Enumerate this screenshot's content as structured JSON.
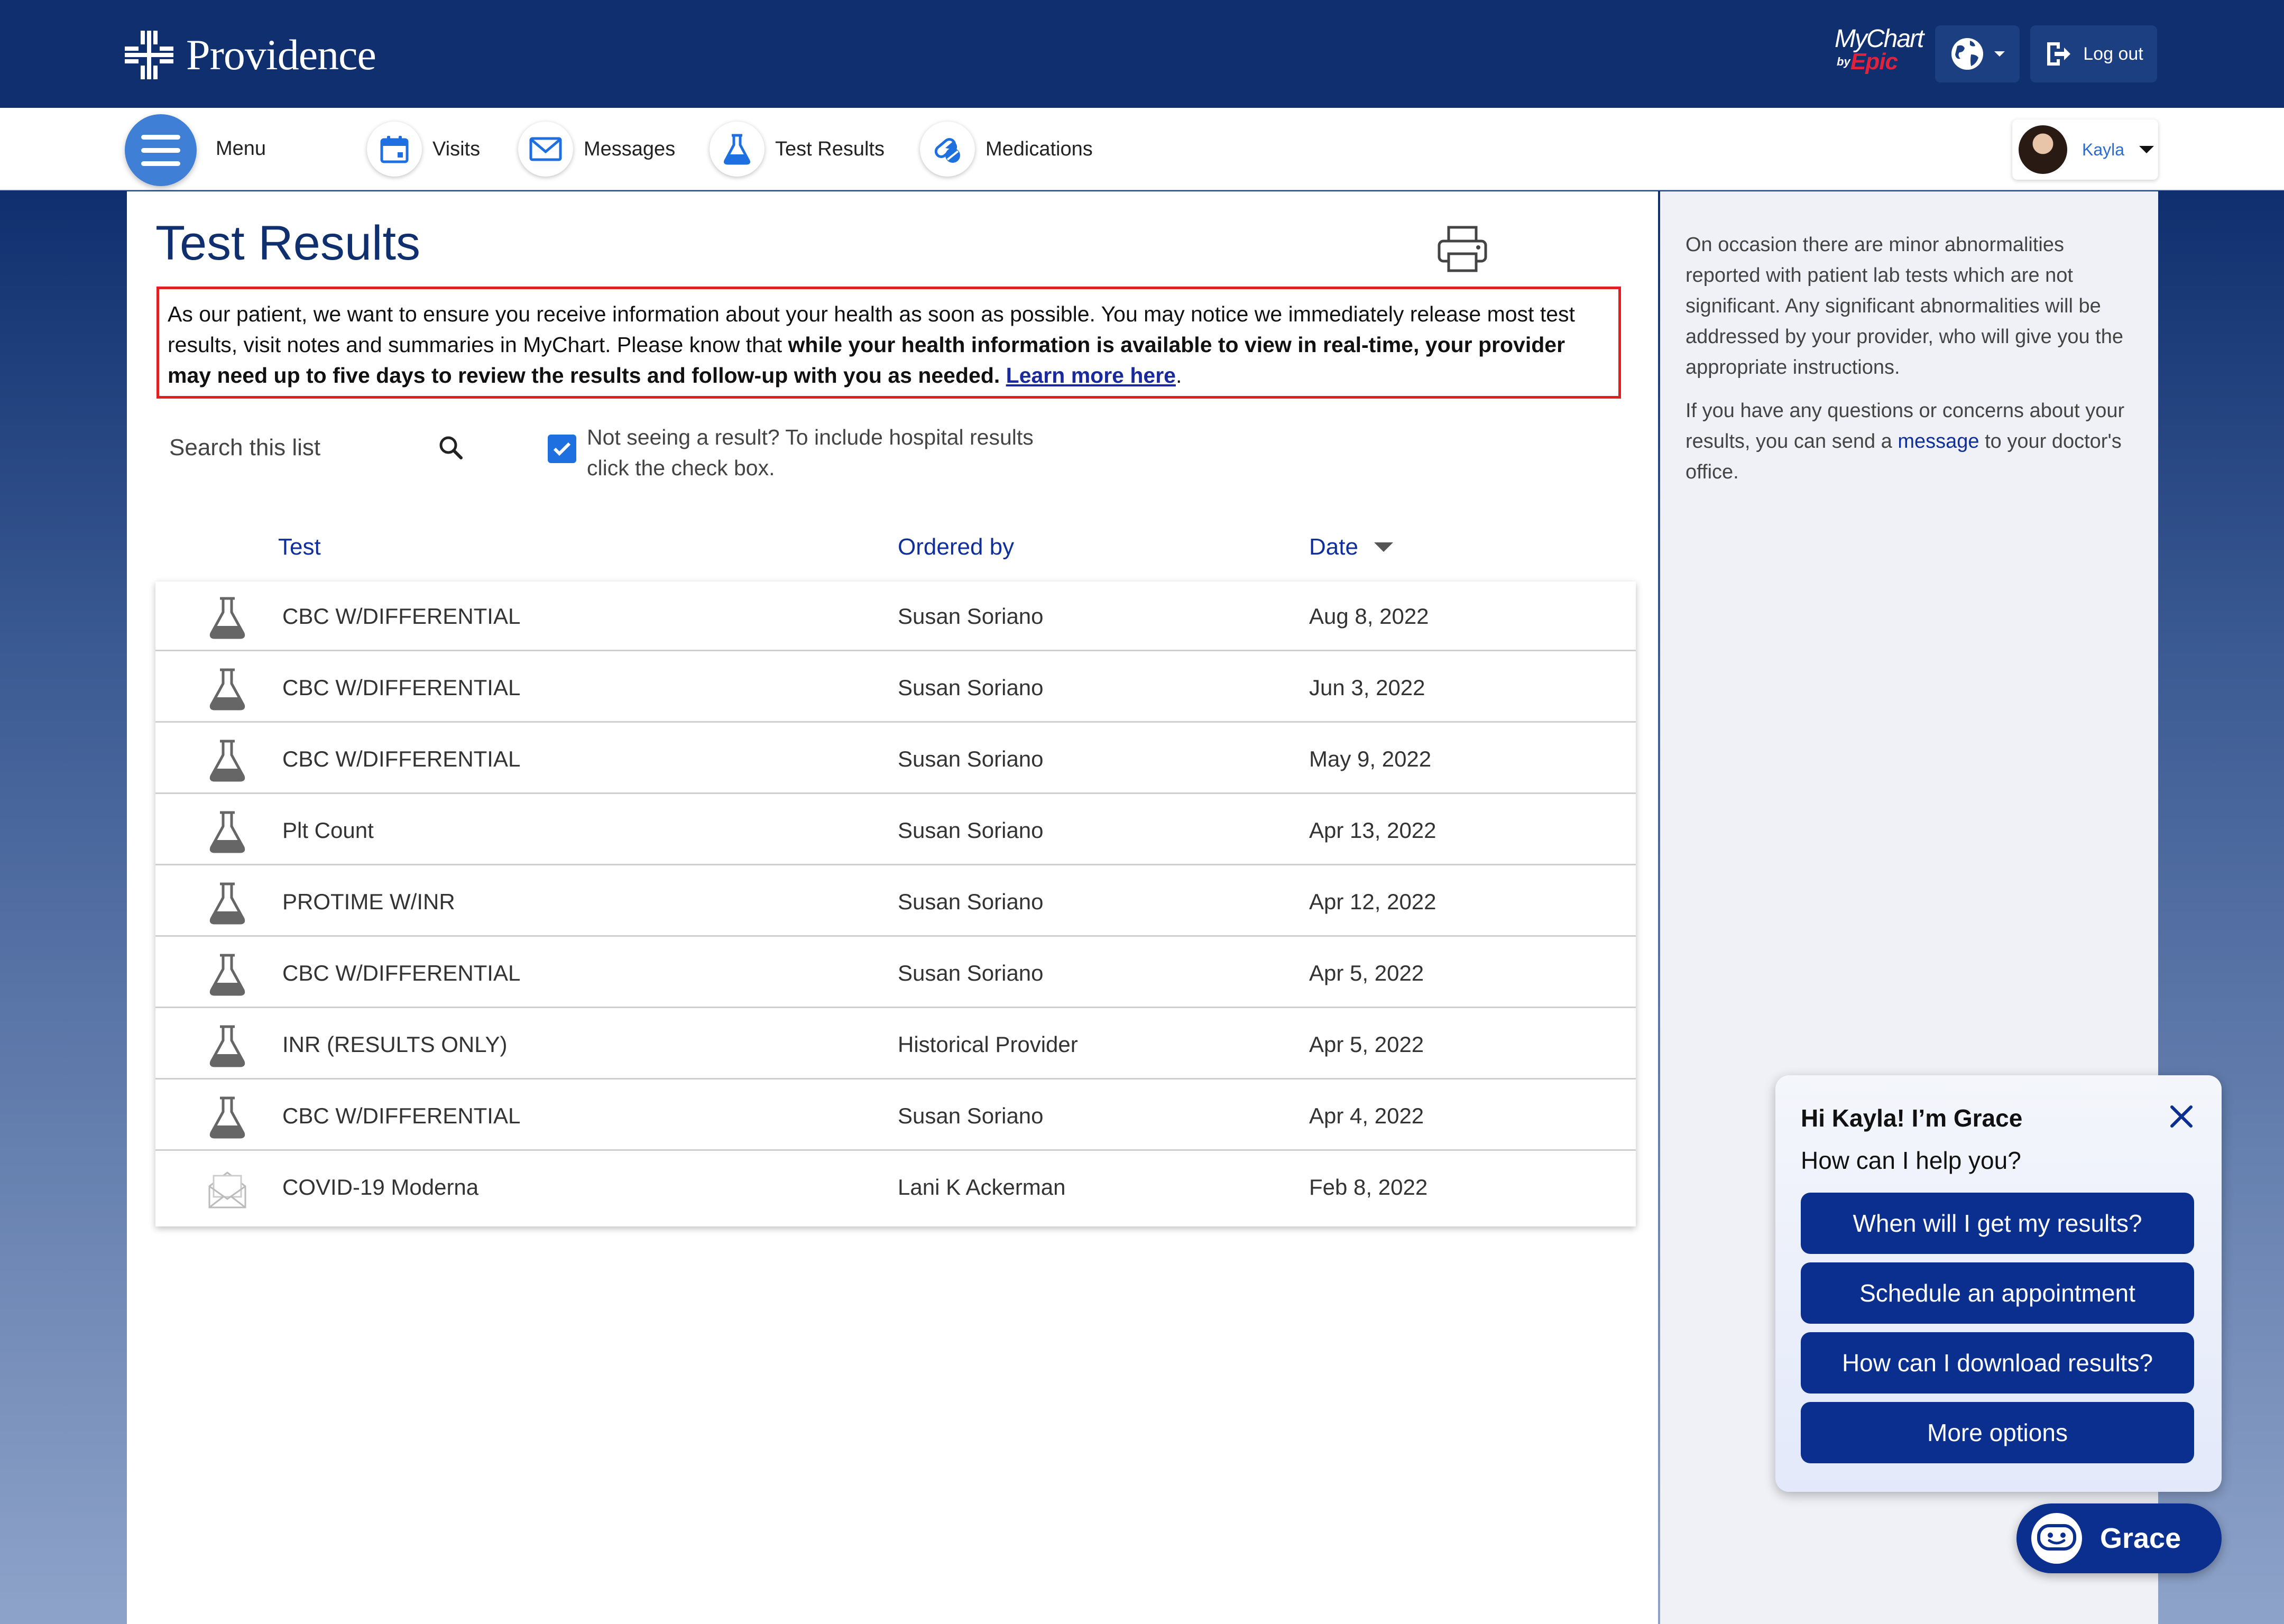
{
  "header": {
    "brand_name": "Providence",
    "mychart_logo": "MyChart",
    "mychart_by": "by",
    "mychart_epic": "Epic",
    "logout_label": "Log out",
    "brand_color": "#0f2f6e"
  },
  "nav": {
    "menu_label": "Menu",
    "items": [
      {
        "label": "Visits",
        "icon": "calendar-icon"
      },
      {
        "label": "Messages",
        "icon": "envelope-icon"
      },
      {
        "label": "Test Results",
        "icon": "flask-icon"
      },
      {
        "label": "Medications",
        "icon": "pills-icon"
      }
    ],
    "user_name": "Kayla"
  },
  "main": {
    "title": "Test Results",
    "notice": {
      "text_1": "As our patient, we want to ensure you receive information about your health as soon as possible. You may notice we immediately release most test results, visit notes and summaries in MyChart. Please know that ",
      "text_bold": "while your health information is available to view in real-time, your provider may need up to five days to review the results and follow-up with you as needed. ",
      "link": "Learn more here",
      "text_end": "."
    },
    "search_placeholder": "Search this list",
    "hospital_checkbox": {
      "checked": true,
      "label": "Not seeing a result? To include hospital results click the check box."
    },
    "columns": {
      "test": "Test",
      "ordered_by": "Ordered by",
      "date": "Date"
    },
    "rows": [
      {
        "icon": "flask-icon",
        "test": "CBC W/DIFFERENTIAL",
        "ordered_by": "Susan Soriano",
        "date": "Aug 8, 2022"
      },
      {
        "icon": "flask-icon",
        "test": "CBC W/DIFFERENTIAL",
        "ordered_by": "Susan Soriano",
        "date": "Jun 3, 2022"
      },
      {
        "icon": "flask-icon",
        "test": "CBC W/DIFFERENTIAL",
        "ordered_by": "Susan Soriano",
        "date": "May 9, 2022"
      },
      {
        "icon": "flask-icon",
        "test": "Plt Count",
        "ordered_by": "Susan Soriano",
        "date": "Apr 13, 2022"
      },
      {
        "icon": "flask-icon",
        "test": "PROTIME W/INR",
        "ordered_by": "Susan Soriano",
        "date": "Apr 12, 2022"
      },
      {
        "icon": "flask-icon",
        "test": "CBC W/DIFFERENTIAL",
        "ordered_by": "Susan Soriano",
        "date": "Apr 5, 2022"
      },
      {
        "icon": "flask-icon",
        "test": "INR (RESULTS ONLY)",
        "ordered_by": "Historical Provider",
        "date": "Apr 5, 2022"
      },
      {
        "icon": "flask-icon",
        "test": "CBC W/DIFFERENTIAL",
        "ordered_by": "Susan Soriano",
        "date": "Apr 4, 2022"
      },
      {
        "icon": "envelope-open-icon",
        "test": "COVID-19 Moderna",
        "ordered_by": "Lani K Ackerman",
        "date": "Feb 8, 2022"
      }
    ]
  },
  "sidebar": {
    "para_1": "On occasion there are minor abnormalities reported with patient lab tests which are not significant. Any significant abnormalities will be addressed by your provider, who will give you the appropriate instructions.",
    "para_2_start": "If you have any questions or concerns about your results, you can send a ",
    "para_2_link": "message",
    "para_2_end": " to your doctor's office."
  },
  "chat": {
    "title": "Hi Kayla! I’m Grace",
    "subtitle": "How can I help you?",
    "options": [
      "When will I get my results?",
      "Schedule an appointment",
      "How can I download results?",
      "More options"
    ],
    "fab_label": "Grace"
  }
}
